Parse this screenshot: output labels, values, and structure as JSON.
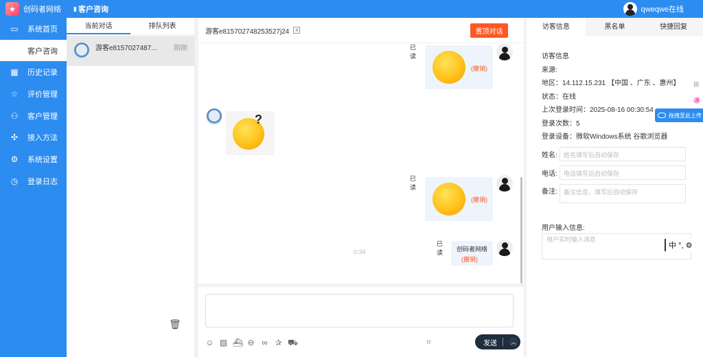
{
  "brand": {
    "name": "创码者网络"
  },
  "header": {
    "title": "客户咨询",
    "user_status": "qweqwe在线"
  },
  "sidebar": {
    "items": [
      {
        "label": "系统首页",
        "icon": "monitor-icon"
      },
      {
        "label": "客户咨询",
        "icon": "",
        "active": true
      },
      {
        "label": "历史记录",
        "icon": "calendar-icon"
      },
      {
        "label": "评价管理",
        "icon": "star-icon"
      },
      {
        "label": "客户管理",
        "icon": "users-icon"
      },
      {
        "label": "接入方法",
        "icon": "puzzle-icon"
      },
      {
        "label": "系统设置",
        "icon": "gear-icon"
      },
      {
        "label": "登录日志",
        "icon": "clock-icon"
      }
    ]
  },
  "conversations": {
    "tabs": [
      "当前对话",
      "排队列表"
    ],
    "items": [
      {
        "name": "游客e8157027487...",
        "time": "刚刚"
      }
    ]
  },
  "chat": {
    "visitor_name": "游客e815702748253527j24",
    "top_button": "置顶对话",
    "read_label": "已读",
    "revoke_label": "(撤销)",
    "timestamp": "0:34",
    "text_message": "创码者网络",
    "send_label": "发送"
  },
  "info": {
    "tabs": [
      "访客信息",
      "黑名单",
      "快捷回复"
    ],
    "title": "访客信息",
    "source_label": "来源:",
    "region": "地区：14.112.15.231 【中国 、广东 、惠州】",
    "status": "状态：在线",
    "last_login": "上次登录时间：2025-08-16 00:30:54",
    "login_count": "登录次数：5",
    "device": "登录设备：微软Windows系统 谷歌浏览器",
    "name_label": "姓名:",
    "name_placeholder": "姓名填写后自动保存",
    "phone_label": "电话:",
    "phone_placeholder": "电话填写后自动保存",
    "note_label": "备注:",
    "note_placeholder": "备注信息，填写后自动保存",
    "user_input_label": "用户输入信息:",
    "user_input_placeholder": "用户实时输入消息"
  },
  "overlay": {
    "ime": "中 °, ⚙",
    "upload_tip": "拖拽至此上传"
  }
}
